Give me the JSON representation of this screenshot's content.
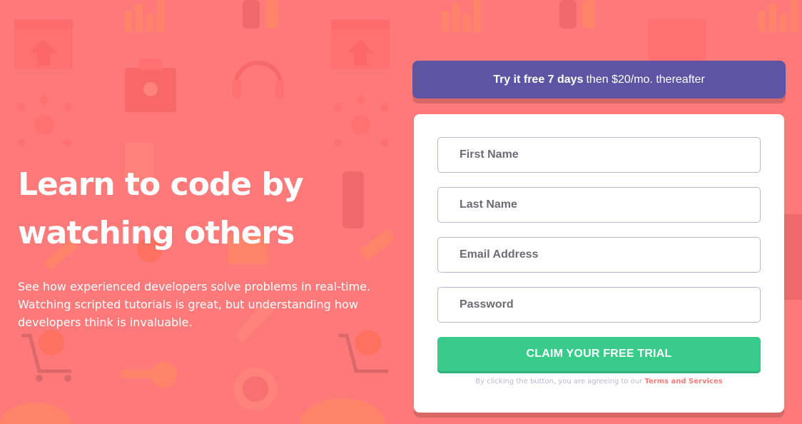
{
  "hero": {
    "title_line1": "Learn to code by",
    "title_line2": "watching others",
    "description": "See how experienced developers solve problems in real-time. Watching scripted tutorials is great, but understanding how developers think is invaluable."
  },
  "promo": {
    "bold": "Try it free 7 days",
    "rest": "then $20/mo. thereafter"
  },
  "form": {
    "first_name_placeholder": "First Name",
    "last_name_placeholder": "Last Name",
    "email_placeholder": "Email Address",
    "password_placeholder": "Password",
    "submit_label": "CLAIM YOUR FREE TRIAL",
    "terms_prefix": "By clicking the button, you are agreeing to our",
    "terms_link": "Terms and Services"
  },
  "colors": {
    "background": "#fe7a7a",
    "promo": "#5e54a4",
    "button": "#38cc8b",
    "terms_link": "#ff7a7a"
  },
  "icons": [
    "analytics-icon",
    "browser-upload-icon",
    "toolbox-icon",
    "headset-icon",
    "network-icon",
    "link-icon",
    "cart-icon",
    "rocket-icon",
    "gear-icon",
    "key-icon",
    "globe-icon",
    "pencil-icon"
  ]
}
